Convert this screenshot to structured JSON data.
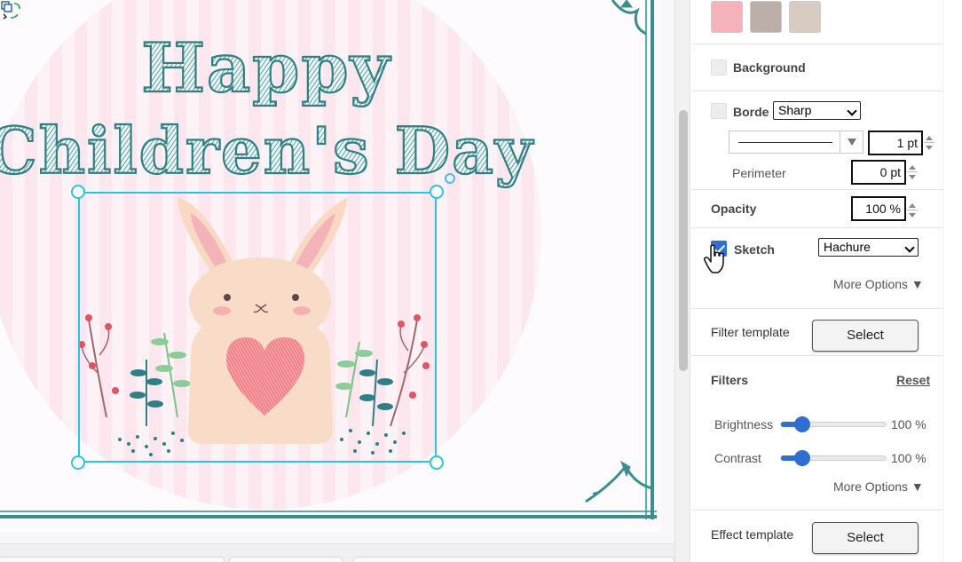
{
  "canvas": {
    "title_line1": "Happy",
    "title_line2": "Children's Day"
  },
  "panel": {
    "swatches": [
      "#f6b2bb",
      "#bcaea8",
      "#d8cbc1"
    ],
    "background": {
      "label": "Background",
      "checked": false
    },
    "border": {
      "label": "Borde",
      "style": "Sharp",
      "width": "1 pt",
      "perimeter_label": "Perimeter",
      "perimeter": "0 pt",
      "checked": false
    },
    "opacity": {
      "label": "Opacity",
      "value": "100 %"
    },
    "sketch": {
      "label": "Sketch",
      "style": "Hachure",
      "checked": true
    },
    "more_options_1": "More Options ▼",
    "filter_template": {
      "label": "Filter template",
      "button": "Select"
    },
    "filters": {
      "label": "Filters",
      "reset": "Reset",
      "brightness_label": "Brightness",
      "brightness_value": "100 %",
      "brightness_fraction": 0.2,
      "contrast_label": "Contrast",
      "contrast_value": "100 %",
      "contrast_fraction": 0.2
    },
    "more_options_2": "More Options ▼",
    "effect_template": {
      "label": "Effect template",
      "button": "Select"
    }
  },
  "colors": {
    "accent": "#2f6fd1",
    "selection": "#2ec3d8",
    "title": "#2f7f83"
  }
}
